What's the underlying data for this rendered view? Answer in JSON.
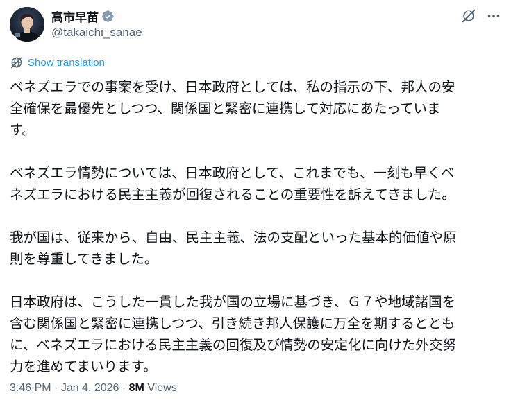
{
  "author": {
    "display_name": "高市早苗",
    "handle": "@takaichi_sanae",
    "verified_badge": "verified-check-icon",
    "badge_color": "#829aab"
  },
  "actions": {
    "grok_icon": "grok-icon",
    "more_icon": "more-horizontal-icon"
  },
  "translation": {
    "label": "Show translation",
    "icon": "translate-globe-icon",
    "color": "#1d9bf0"
  },
  "post": {
    "paragraphs": [
      "ベネズエラでの事案を受け、日本政府としては、私の指示の下、邦人の安\n全確保を最優先としつつ、関係国と緊密に連携して対応にあたっていま\nす。",
      "ベネズエラ情勢については、日本政府として、これまでも、一刻も早くベ\nネズエラにおける民主主義が回復されることの重要性を訴えてきました。",
      "我が国は、従来から、自由、民主主義、法の支配といった基本的価値や原\n則を尊重してきました。",
      "日本政府は、こうした一貫した我が国の立場に基づき、Ｇ７や地域諸国を\n含む関係国と緊密に連携しつつ、引き続き邦人保護に万全を期するととも\nに、ベネズエラにおける民主主義の回復及び情勢の安定化に向けた外交努\n力を進めてまいります。"
    ]
  },
  "meta": {
    "time": "3:46 PM",
    "separator": " · ",
    "date": "Jan 4, 2026",
    "views_count": "8M",
    "views_label": "Views"
  }
}
